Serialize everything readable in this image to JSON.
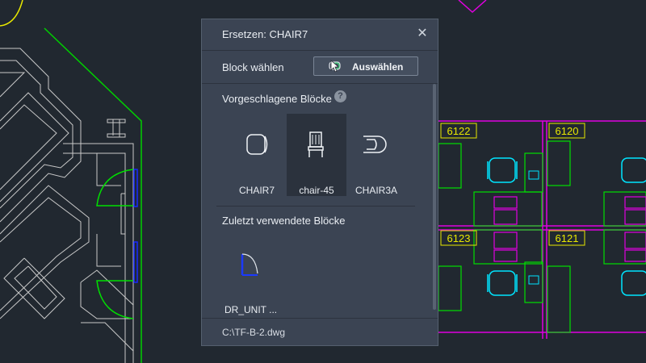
{
  "dialog": {
    "title": "Ersetzen: CHAIR7",
    "close_icon": "close-icon",
    "block_label": "Block wählen",
    "select_button": "Auswählen",
    "suggested_title": "Vorgeschlagene Blöcke",
    "suggested": [
      {
        "label": "CHAIR7",
        "icon": "chair7-icon"
      },
      {
        "label": "chair-45",
        "icon": "chair-45-icon"
      },
      {
        "label": "CHAIR3A",
        "icon": "chair3a-icon"
      }
    ],
    "recent_title": "Zuletzt verwendete Blöcke",
    "recent": [
      {
        "label": "DR_UNIT ...",
        "icon": "door-unit-icon"
      }
    ],
    "footer_path": "C:\\TF-B-2.dwg"
  },
  "drawing": {
    "rooms": [
      "6122",
      "6120",
      "6123",
      "6121"
    ]
  },
  "colors": {
    "background": "#212830",
    "dialog": "#3b4453",
    "green": "#00e000",
    "magenta": "#e000e0",
    "cyan": "#00e5ff",
    "yellow": "#e8e800",
    "blue": "#1020ff",
    "white_lines": "#c8c8c8"
  }
}
